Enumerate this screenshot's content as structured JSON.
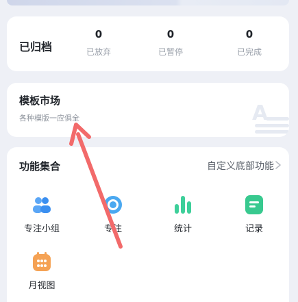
{
  "archived": {
    "title": "已归档",
    "stats": [
      {
        "count": "0",
        "label": "已放弃"
      },
      {
        "count": "0",
        "label": "已暂停"
      },
      {
        "count": "0",
        "label": "已完成"
      }
    ]
  },
  "template_market": {
    "title": "模板市场",
    "subtitle": "各种模版一应俱全"
  },
  "functions": {
    "title": "功能集合",
    "customize_label": "自定义底部功能",
    "items": [
      {
        "label": "专注小组",
        "icon": "group-icon",
        "color": "#4a9cf5"
      },
      {
        "label": "专注",
        "icon": "focus-ring-icon",
        "color": "#4aa8f0"
      },
      {
        "label": "统计",
        "icon": "bar-chart-icon",
        "color": "#3ecf9a"
      },
      {
        "label": "记录",
        "icon": "note-icon",
        "color": "#38c98f"
      },
      {
        "label": "月视图",
        "icon": "calendar-icon",
        "color": "#f5a254"
      }
    ]
  },
  "annotation": {
    "color": "#f26a6a"
  }
}
